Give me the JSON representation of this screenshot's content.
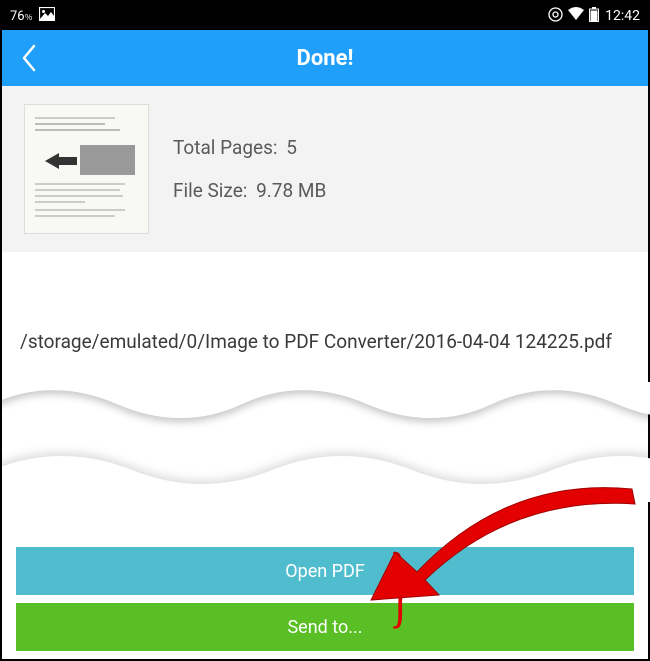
{
  "status_bar": {
    "battery_percent": "76",
    "time": "12:42",
    "icons": {
      "picture": "picture-icon",
      "sync": "sync-icon",
      "wifi": "wifi-icon",
      "battery": "battery-icon"
    },
    "percent_glyph": "％"
  },
  "header": {
    "title": "Done!",
    "back": "back"
  },
  "info": {
    "total_pages_label": "Total Pages:",
    "total_pages_value": "5",
    "file_size_label": "File Size:",
    "file_size_value": "9.78 MB"
  },
  "file_path": "/storage/emulated/0/Image to PDF Converter/2016-04-04 124225.pdf",
  "actions": {
    "open_pdf": "Open PDF",
    "send_to": "Send to..."
  },
  "colors": {
    "header_bg": "#1f9efa",
    "open_btn": "#4fbdcd",
    "send_btn": "#5abf24",
    "arrow": "#e20000"
  }
}
